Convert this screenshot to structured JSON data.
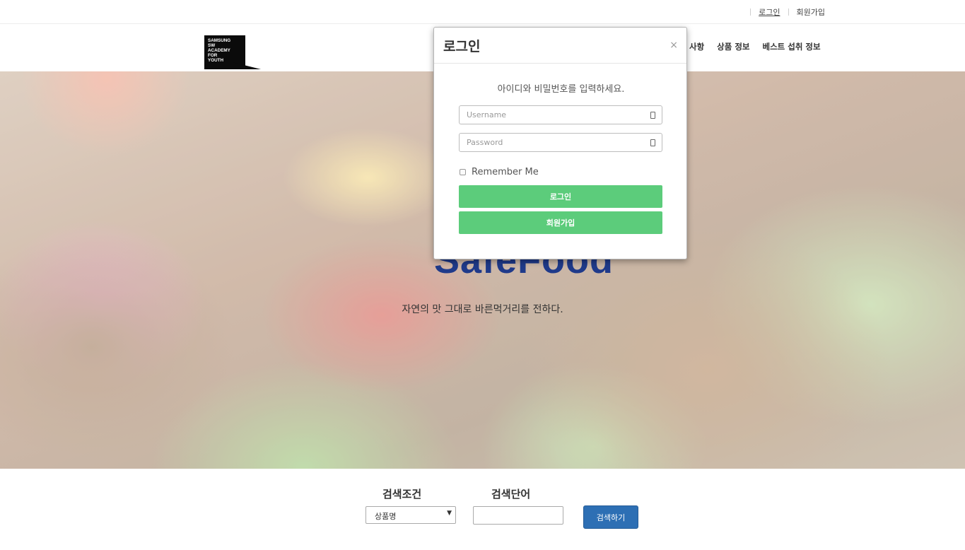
{
  "topbar": {
    "login_link": "로그인",
    "join_link": "회원가입"
  },
  "header": {
    "logo_text": "SAMSUNG\nSW\nACADEMY\nFOR\nYOUTH",
    "nav_items": [
      "사항",
      "상품 정보",
      "베스트 섭취 정보"
    ]
  },
  "hero": {
    "title": "SafeFood",
    "subtitle": "자연의 맛 그대로 바른먹거리를 전하다."
  },
  "search": {
    "condition_label": "검색조건",
    "word_label": "검색단어",
    "condition_selected": "상품명",
    "word_value": "",
    "button_label": "검색하기"
  },
  "modal": {
    "title": "로그인",
    "close_glyph": "×",
    "message": "아이디와 비밀번호를 입력하세요.",
    "username_placeholder": "Username",
    "password_placeholder": "Password",
    "remember_label": "Remember Me",
    "login_button": "로그인",
    "join_button": "회원가입"
  },
  "colors": {
    "brand_green": "#5ccc7b",
    "search_button": "#2d6fb4",
    "hero_title": "#1f3a8a"
  },
  "icons": [
    "lock-icon",
    "user-icon",
    "close-icon",
    "chevron-down-icon"
  ]
}
